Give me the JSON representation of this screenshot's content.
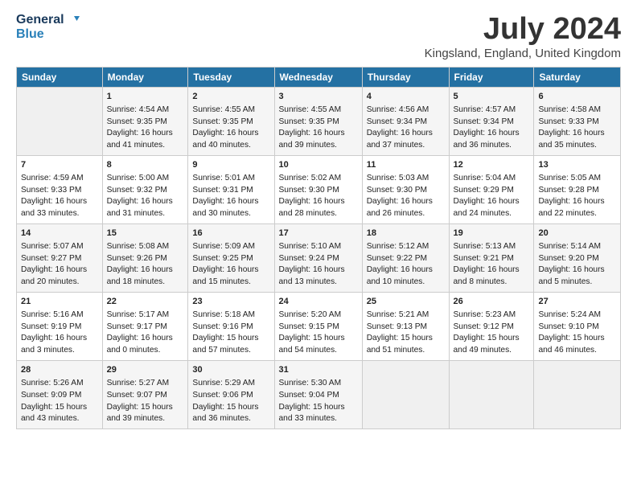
{
  "logo": {
    "line1": "General",
    "line2": "Blue"
  },
  "title": "July 2024",
  "subtitle": "Kingsland, England, United Kingdom",
  "days_header": [
    "Sunday",
    "Monday",
    "Tuesday",
    "Wednesday",
    "Thursday",
    "Friday",
    "Saturday"
  ],
  "weeks": [
    [
      {
        "day": "",
        "content": ""
      },
      {
        "day": "1",
        "content": "Sunrise: 4:54 AM\nSunset: 9:35 PM\nDaylight: 16 hours\nand 41 minutes."
      },
      {
        "day": "2",
        "content": "Sunrise: 4:55 AM\nSunset: 9:35 PM\nDaylight: 16 hours\nand 40 minutes."
      },
      {
        "day": "3",
        "content": "Sunrise: 4:55 AM\nSunset: 9:35 PM\nDaylight: 16 hours\nand 39 minutes."
      },
      {
        "day": "4",
        "content": "Sunrise: 4:56 AM\nSunset: 9:34 PM\nDaylight: 16 hours\nand 37 minutes."
      },
      {
        "day": "5",
        "content": "Sunrise: 4:57 AM\nSunset: 9:34 PM\nDaylight: 16 hours\nand 36 minutes."
      },
      {
        "day": "6",
        "content": "Sunrise: 4:58 AM\nSunset: 9:33 PM\nDaylight: 16 hours\nand 35 minutes."
      }
    ],
    [
      {
        "day": "7",
        "content": "Sunrise: 4:59 AM\nSunset: 9:33 PM\nDaylight: 16 hours\nand 33 minutes."
      },
      {
        "day": "8",
        "content": "Sunrise: 5:00 AM\nSunset: 9:32 PM\nDaylight: 16 hours\nand 31 minutes."
      },
      {
        "day": "9",
        "content": "Sunrise: 5:01 AM\nSunset: 9:31 PM\nDaylight: 16 hours\nand 30 minutes."
      },
      {
        "day": "10",
        "content": "Sunrise: 5:02 AM\nSunset: 9:30 PM\nDaylight: 16 hours\nand 28 minutes."
      },
      {
        "day": "11",
        "content": "Sunrise: 5:03 AM\nSunset: 9:30 PM\nDaylight: 16 hours\nand 26 minutes."
      },
      {
        "day": "12",
        "content": "Sunrise: 5:04 AM\nSunset: 9:29 PM\nDaylight: 16 hours\nand 24 minutes."
      },
      {
        "day": "13",
        "content": "Sunrise: 5:05 AM\nSunset: 9:28 PM\nDaylight: 16 hours\nand 22 minutes."
      }
    ],
    [
      {
        "day": "14",
        "content": "Sunrise: 5:07 AM\nSunset: 9:27 PM\nDaylight: 16 hours\nand 20 minutes."
      },
      {
        "day": "15",
        "content": "Sunrise: 5:08 AM\nSunset: 9:26 PM\nDaylight: 16 hours\nand 18 minutes."
      },
      {
        "day": "16",
        "content": "Sunrise: 5:09 AM\nSunset: 9:25 PM\nDaylight: 16 hours\nand 15 minutes."
      },
      {
        "day": "17",
        "content": "Sunrise: 5:10 AM\nSunset: 9:24 PM\nDaylight: 16 hours\nand 13 minutes."
      },
      {
        "day": "18",
        "content": "Sunrise: 5:12 AM\nSunset: 9:22 PM\nDaylight: 16 hours\nand 10 minutes."
      },
      {
        "day": "19",
        "content": "Sunrise: 5:13 AM\nSunset: 9:21 PM\nDaylight: 16 hours\nand 8 minutes."
      },
      {
        "day": "20",
        "content": "Sunrise: 5:14 AM\nSunset: 9:20 PM\nDaylight: 16 hours\nand 5 minutes."
      }
    ],
    [
      {
        "day": "21",
        "content": "Sunrise: 5:16 AM\nSunset: 9:19 PM\nDaylight: 16 hours\nand 3 minutes."
      },
      {
        "day": "22",
        "content": "Sunrise: 5:17 AM\nSunset: 9:17 PM\nDaylight: 16 hours\nand 0 minutes."
      },
      {
        "day": "23",
        "content": "Sunrise: 5:18 AM\nSunset: 9:16 PM\nDaylight: 15 hours\nand 57 minutes."
      },
      {
        "day": "24",
        "content": "Sunrise: 5:20 AM\nSunset: 9:15 PM\nDaylight: 15 hours\nand 54 minutes."
      },
      {
        "day": "25",
        "content": "Sunrise: 5:21 AM\nSunset: 9:13 PM\nDaylight: 15 hours\nand 51 minutes."
      },
      {
        "day": "26",
        "content": "Sunrise: 5:23 AM\nSunset: 9:12 PM\nDaylight: 15 hours\nand 49 minutes."
      },
      {
        "day": "27",
        "content": "Sunrise: 5:24 AM\nSunset: 9:10 PM\nDaylight: 15 hours\nand 46 minutes."
      }
    ],
    [
      {
        "day": "28",
        "content": "Sunrise: 5:26 AM\nSunset: 9:09 PM\nDaylight: 15 hours\nand 43 minutes."
      },
      {
        "day": "29",
        "content": "Sunrise: 5:27 AM\nSunset: 9:07 PM\nDaylight: 15 hours\nand 39 minutes."
      },
      {
        "day": "30",
        "content": "Sunrise: 5:29 AM\nSunset: 9:06 PM\nDaylight: 15 hours\nand 36 minutes."
      },
      {
        "day": "31",
        "content": "Sunrise: 5:30 AM\nSunset: 9:04 PM\nDaylight: 15 hours\nand 33 minutes."
      },
      {
        "day": "",
        "content": ""
      },
      {
        "day": "",
        "content": ""
      },
      {
        "day": "",
        "content": ""
      }
    ]
  ]
}
